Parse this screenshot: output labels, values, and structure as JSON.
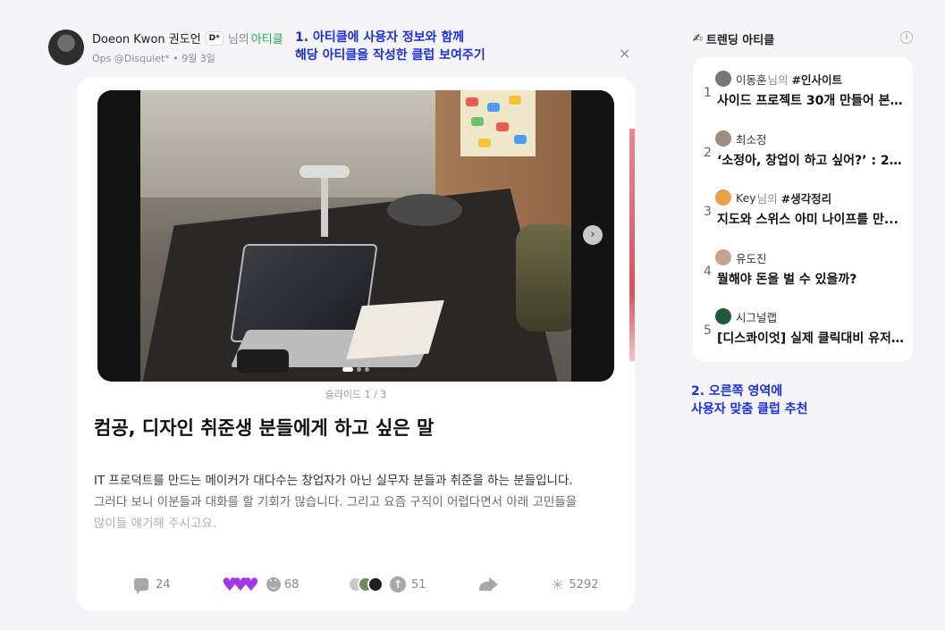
{
  "post": {
    "author": {
      "name": "Doeon Kwon 권도언",
      "badge": "D*",
      "nim_text": "님의",
      "club_label": "아티클",
      "meta": "Ops @Disquiet* • 9월 3일"
    },
    "slide_label": "슬라이드 1 / 3",
    "title": "컴공, 디자인 취준생 분들에게 하고 싶은 말",
    "body": [
      "IT 프로덕트를 만드는 메이커가 대다수는 창업자가 아닌 실무자 분들과 취준을 하는 분들입니다.",
      "그러다 보니 이분들과 대화를 할 기회가 많습니다. 그리고 요즘 구직이 어렵다면서 아래 고민들을",
      "많이들 얘기해 주시고요."
    ],
    "actions": {
      "comments": "24",
      "reactions": "68",
      "upvotes": "51",
      "views": "5292"
    },
    "close_glyph": "×",
    "next_glyph": "›"
  },
  "annotations": {
    "note1": [
      "1. 아티클에 사용자 정보와 함께",
      "    해당 아티클을 작성한 클럽 보여주기"
    ],
    "note2": [
      "2. 오른쪽 영역에",
      "    사용자 맞춤 클럽 추천"
    ]
  },
  "trending": {
    "header": "트렌딩 아티클",
    "items": [
      {
        "rank": "1",
        "author": "이동훈",
        "nim": "님의",
        "tag": "#인사이트",
        "title": "사이드 프로젝트 30개 만들어 본 ..."
      },
      {
        "rank": "2",
        "author": "최소정",
        "nim": "",
        "tag": "",
        "title": "‘소정아, 창업이 하고 싶어?’ : 22..."
      },
      {
        "rank": "3",
        "author": "Key",
        "nim": "님의",
        "tag": "#생각정리",
        "title": "지도와 스위스 아미 나이프를 만..."
      },
      {
        "rank": "4",
        "author": "유도진",
        "nim": "",
        "tag": "",
        "title": "뭘해야 돈을 벌 수 있을까?"
      },
      {
        "rank": "5",
        "author": "시그널랩",
        "nim": "",
        "tag": "",
        "title": "[디스콰이엇] 실제 클릭대비 유저 ..."
      }
    ]
  },
  "colors": {
    "accent_green": "#22b24c",
    "annotation_blue": "#1a2ee8",
    "heart_purple": "#a235e8"
  },
  "icons": [
    "avatar",
    "close-icon",
    "chevron-right-icon",
    "comment-icon",
    "heart-icon",
    "smile-icon",
    "upvote-icon",
    "share-icon",
    "views-icon",
    "info-icon",
    "pen-icon"
  ]
}
